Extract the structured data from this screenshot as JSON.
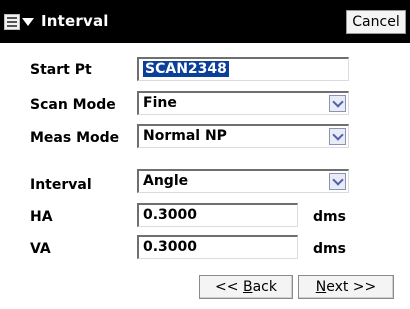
{
  "window": {
    "title": "Interval",
    "cancel_label": "Cancel"
  },
  "fields": {
    "start_pt": {
      "label": "Start Pt",
      "value": "SCAN2348"
    },
    "scan_mode": {
      "label": "Scan Mode",
      "value": "Fine"
    },
    "meas_mode": {
      "label": "Meas Mode",
      "value": "Normal NP"
    },
    "interval": {
      "label": "Interval",
      "value": "Angle"
    },
    "ha": {
      "label": "HA",
      "value": "0.3000",
      "unit": "dms"
    },
    "va": {
      "label": "VA",
      "value": "0.3000",
      "unit": "dms"
    }
  },
  "buttons": {
    "back_prefix": "<< ",
    "back_mnemonic": "B",
    "back_rest": "ack",
    "next_mnemonic": "N",
    "next_rest": "ext >>"
  },
  "icons": [
    "menu-icon",
    "dropdown-triangle-icon",
    "chevron-down-icon"
  ]
}
